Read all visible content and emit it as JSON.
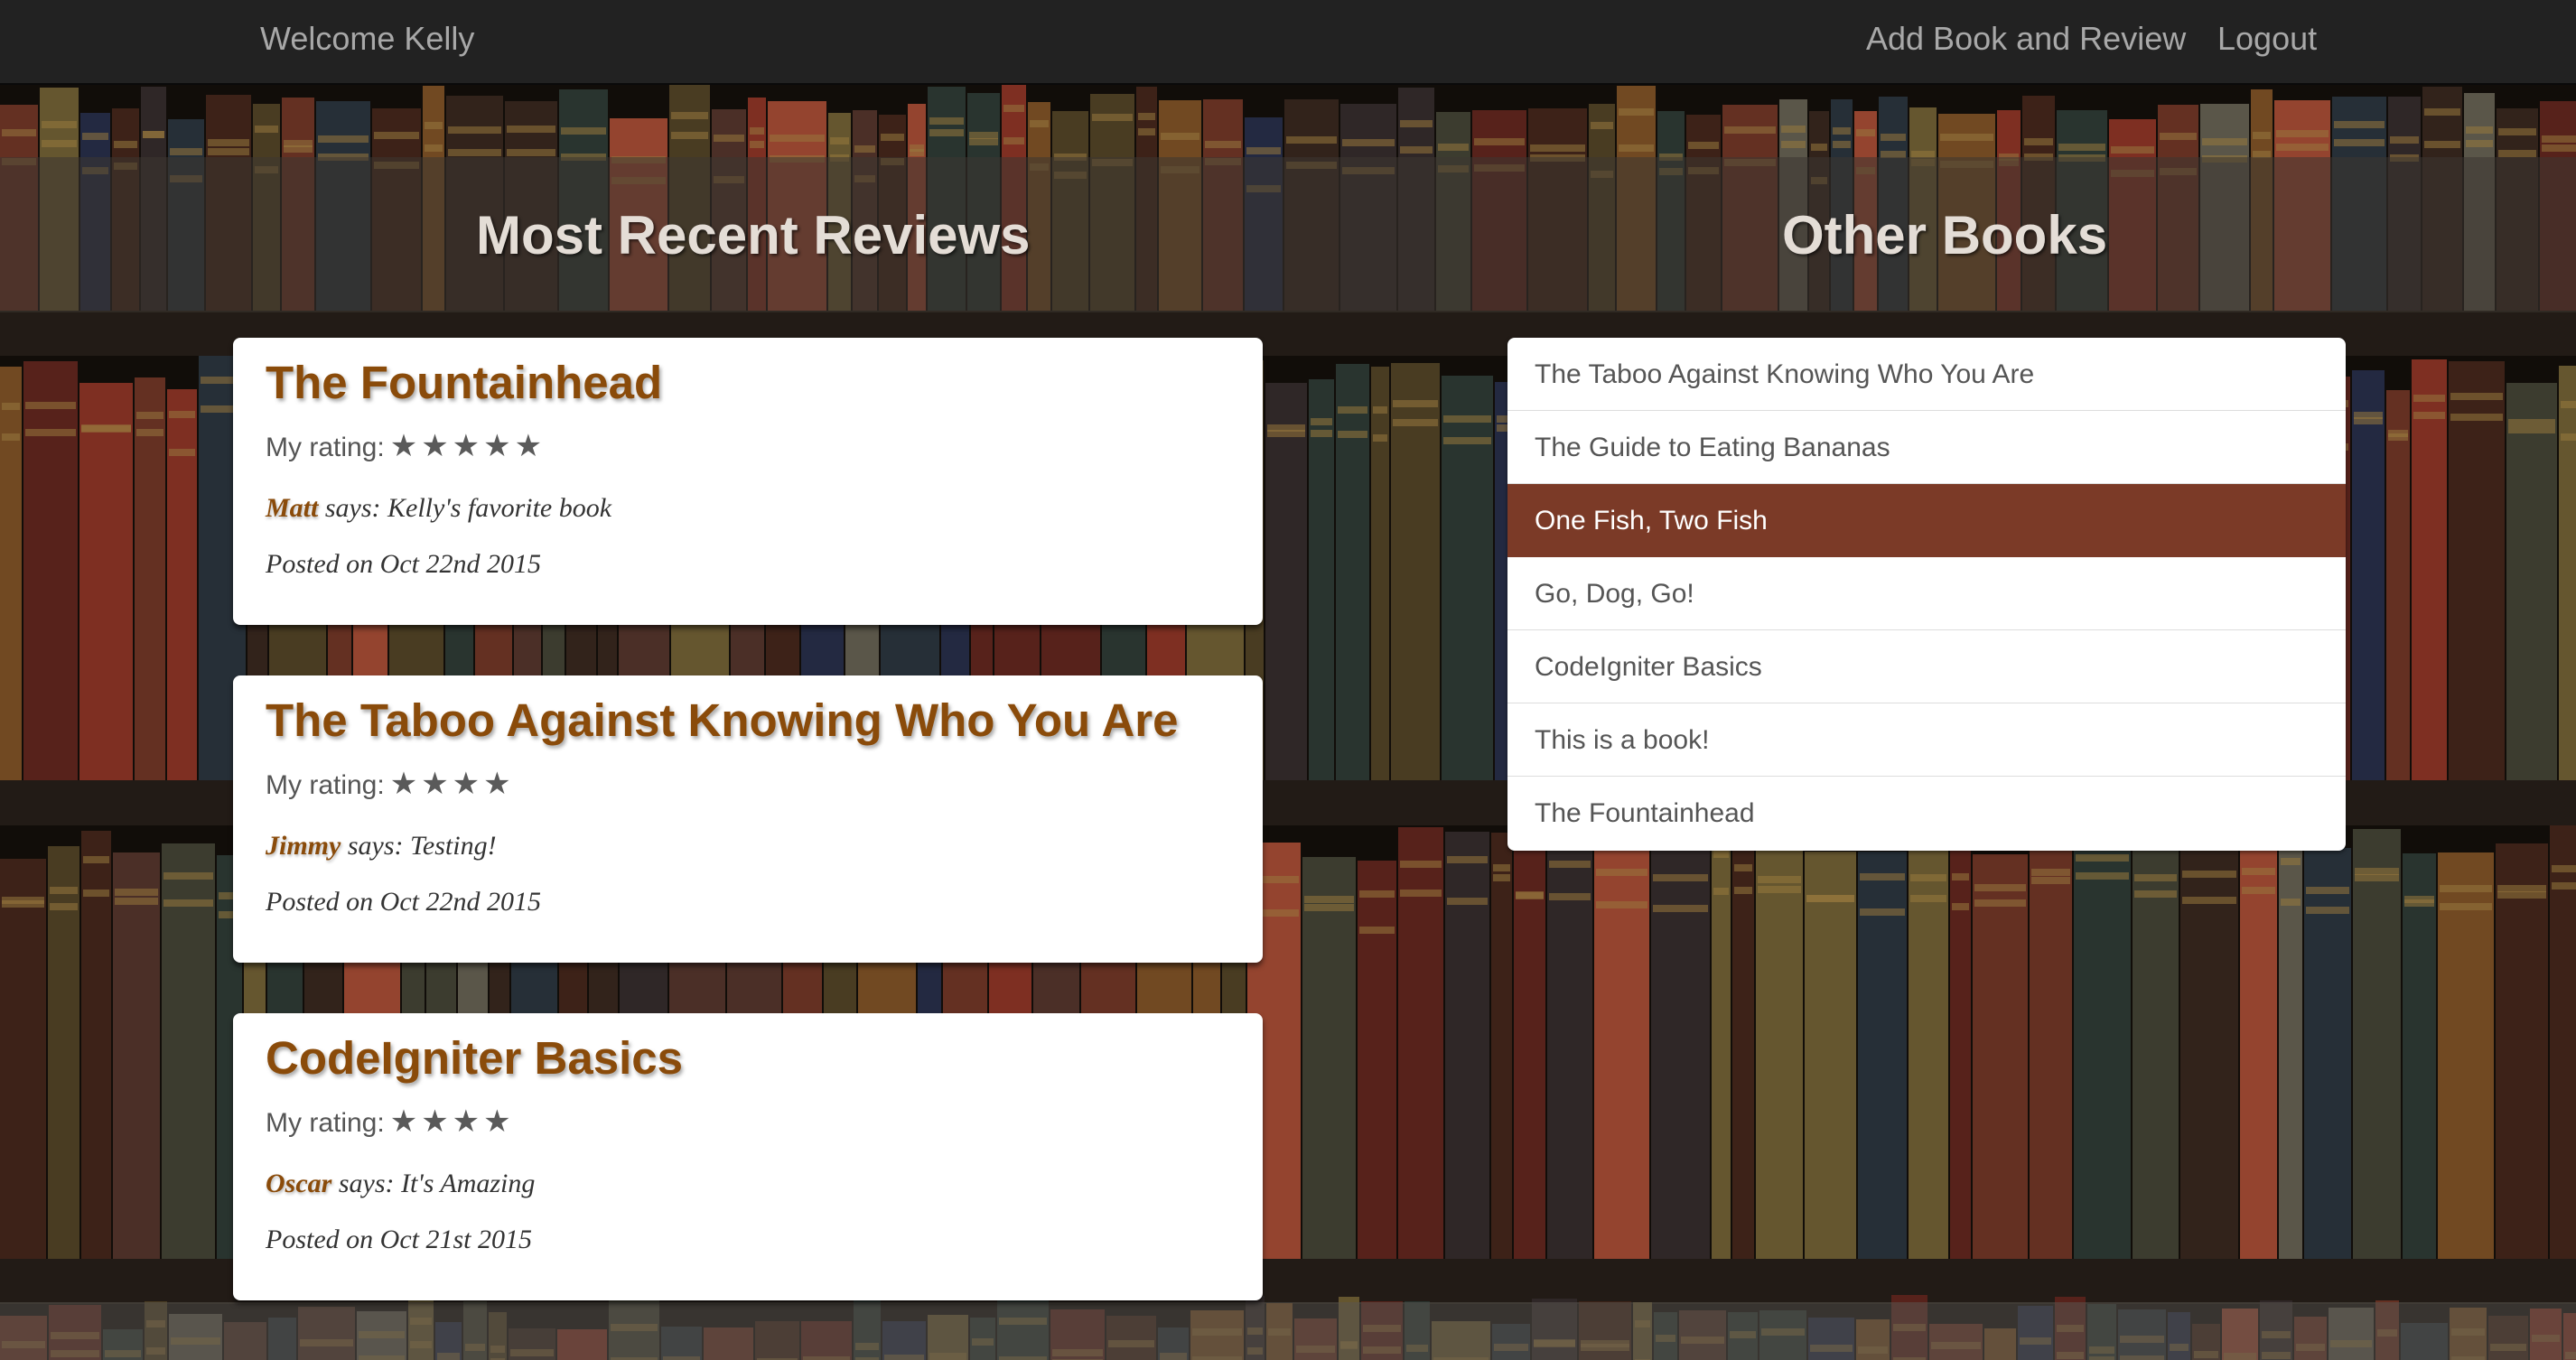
{
  "navbar": {
    "welcome": "Welcome Kelly",
    "add_book": "Add Book and Review",
    "logout": "Logout"
  },
  "headings": {
    "recent_reviews": "Most Recent Reviews",
    "other_books": "Other Books"
  },
  "reviews": [
    {
      "title": "The Fountainhead",
      "rating_label": "My rating:",
      "stars": "★★★★★",
      "rating": 5,
      "reviewer": "Matt",
      "says": " says: Kelly's favorite book",
      "posted": "Posted on Oct 22nd 2015"
    },
    {
      "title": "The Taboo Against Knowing Who You Are",
      "rating_label": "My rating:",
      "stars": "★★★★",
      "rating": 4,
      "reviewer": "Jimmy",
      "says": " says: Testing!",
      "posted": "Posted on Oct 22nd 2015"
    },
    {
      "title": "CodeIgniter Basics",
      "rating_label": "My rating:",
      "stars": "★★★★",
      "rating": 4,
      "reviewer": "Oscar",
      "says": " says: It's Amazing",
      "posted": "Posted on Oct 21st 2015"
    }
  ],
  "other_books": [
    "The Taboo Against Knowing Who You Are",
    "The Guide to Eating Bananas",
    "One Fish, Two Fish",
    "Go, Dog, Go!",
    "CodeIgniter Basics",
    "This is a book!",
    "The Fountainhead"
  ],
  "active_book": "One Fish, Two Fish",
  "colors": {
    "navbar": "#222222",
    "accent_title": "#8a4b0a",
    "active_item": "#7b3a27",
    "heading": "#e4ddd6"
  }
}
